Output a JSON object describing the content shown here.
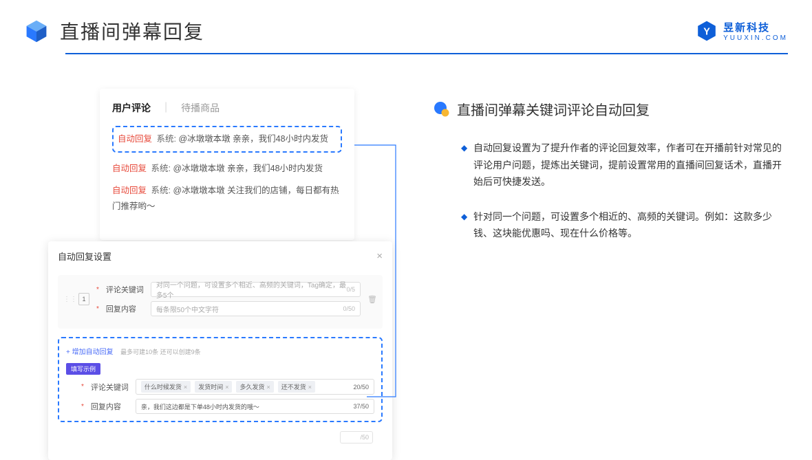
{
  "header": {
    "title": "直播间弹幕回复",
    "brand_cn": "昱新科技",
    "brand_en": "YUUXIN.COM"
  },
  "comments": {
    "tab_active": "用户评论",
    "tab_inactive": "待播商品",
    "highlight": {
      "tag": "自动回复",
      "sys": "系统:",
      "text": "@冰墩墩本墩 亲亲，我们48小时内发货"
    },
    "row2": {
      "tag": "自动回复",
      "sys": "系统:",
      "text": "@冰墩墩本墩 亲亲，我们48小时内发货"
    },
    "row3": {
      "tag": "自动回复",
      "sys": "系统:",
      "text": "@冰墩墩本墩 关注我们的店铺，每日都有热门推荐哟～"
    }
  },
  "settings": {
    "title": "自动回复设置",
    "seq": "1",
    "keyword_label": "评论关键词",
    "keyword_placeholder": "对同一个问题，可设置多个相近、高频的关键词，Tag确定，最多5个",
    "keyword_count": "0/5",
    "content_label": "回复内容",
    "content_placeholder": "每条限50个中文字符",
    "content_count": "0/50",
    "add_link": "+ 增加自动回复",
    "add_hint": "最多可建10条 还可以创建9条",
    "example_badge": "填写示例",
    "ex_keyword_label": "评论关键词",
    "ex_tags": [
      "什么时候发货",
      "发货时间",
      "多久发货",
      "还不发货"
    ],
    "ex_keyword_count": "20/50",
    "ex_content_label": "回复内容",
    "ex_content_value": "亲，我们这边都是下单48小时内发货的哦～",
    "ex_content_count": "37/50",
    "ghost_count": "/50"
  },
  "sub": {
    "title": "直播间弹幕关键词评论自动回复",
    "bullets": [
      "自动回复设置为了提升作者的评论回复效率，作者可在开播前针对常见的评论用户问题，提炼出关键词，提前设置常用的直播间回复话术，直播开始后可快捷发送。",
      "针对同一个问题，可设置多个相近的、高频的关键词。例如：这款多少钱、这块能优惠吗、现在什么价格等。"
    ]
  }
}
